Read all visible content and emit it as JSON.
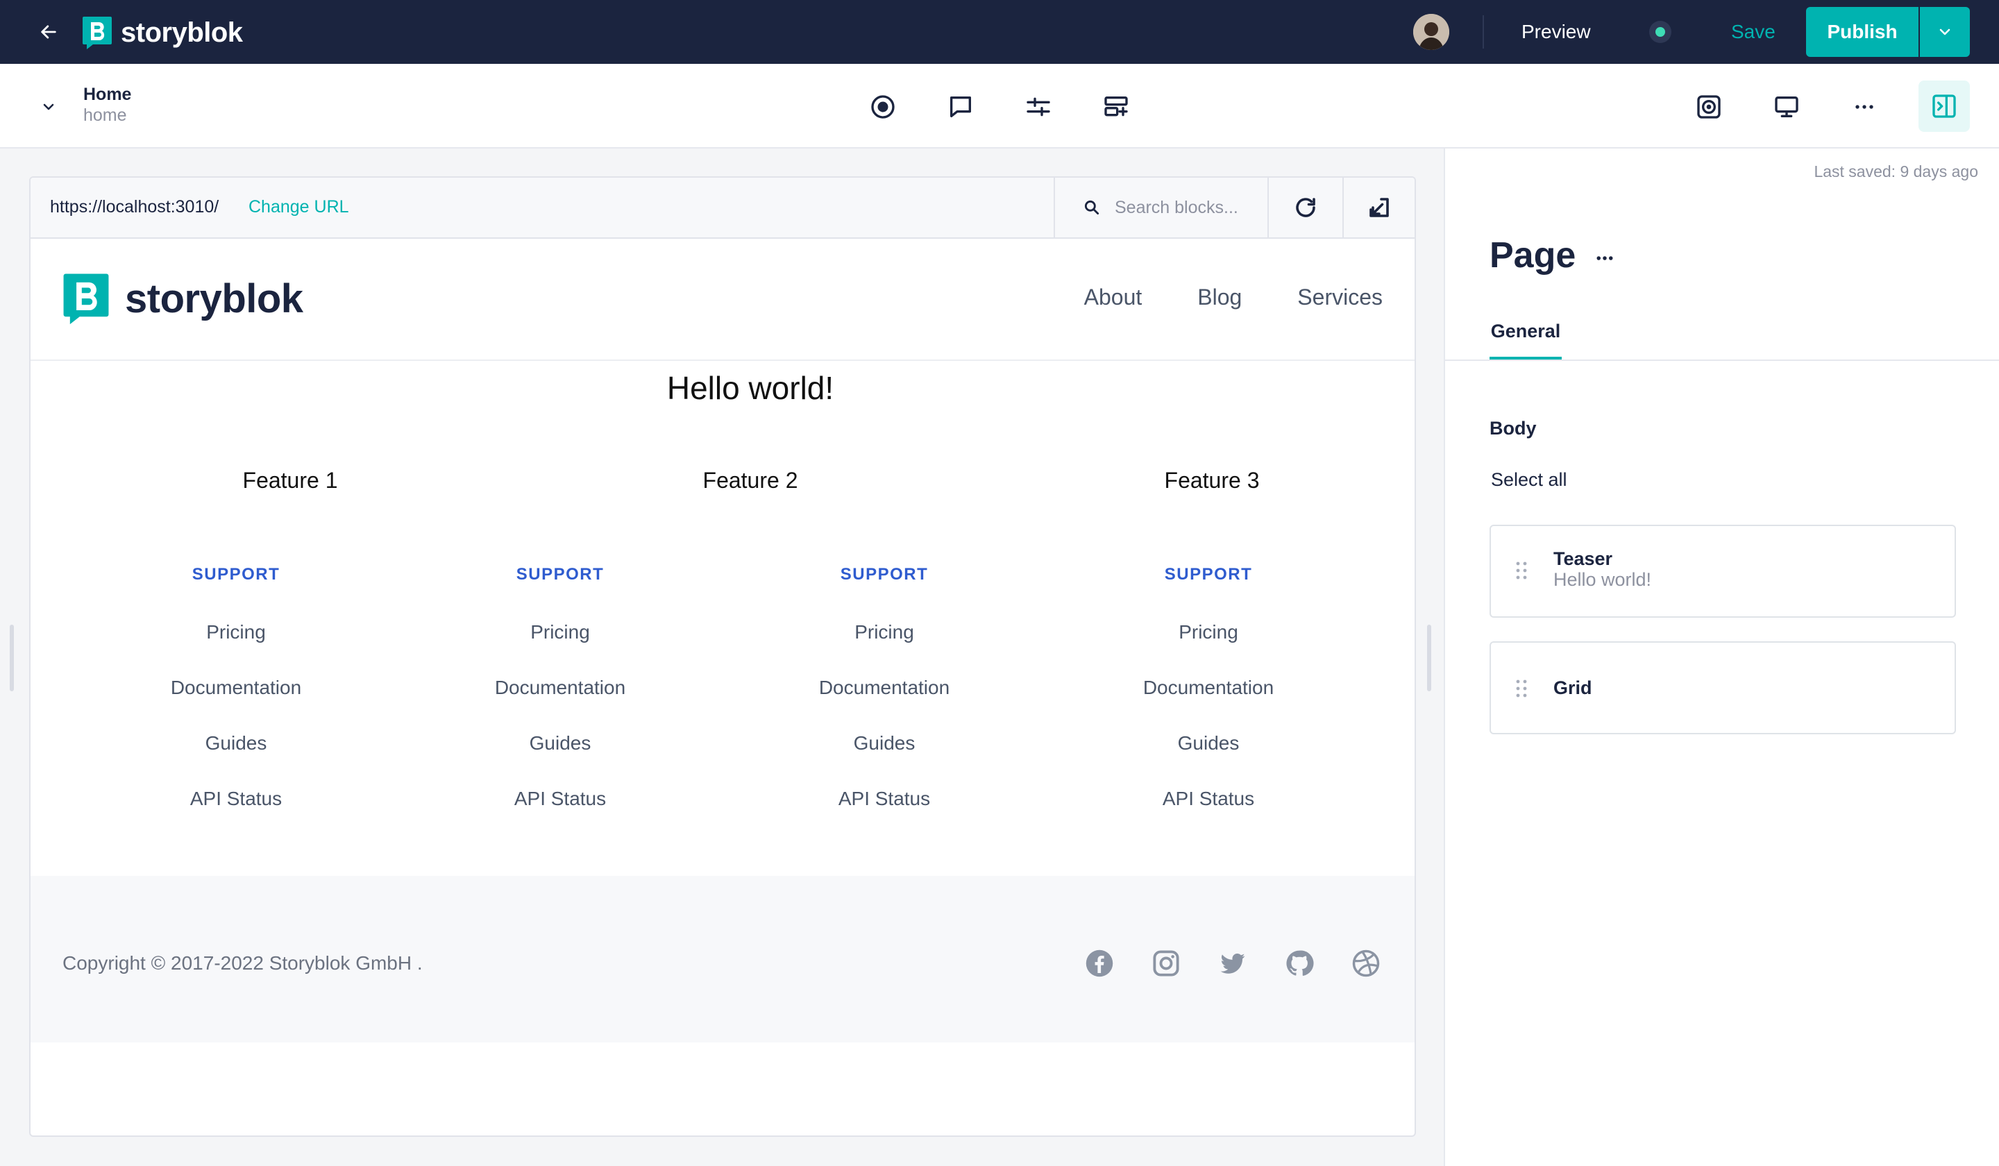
{
  "app": {
    "brand": "storyblok",
    "preview_label": "Preview",
    "save_label": "Save",
    "publish_label": "Publish"
  },
  "story": {
    "title": "Home",
    "slug": "home"
  },
  "toolbar_icons": [
    "target-icon",
    "comment-icon",
    "sliders-icon",
    "add-block-icon"
  ],
  "toolbar_right_icons": [
    "screenshot-icon",
    "desktop-icon",
    "more-icon",
    "panel-toggle-icon"
  ],
  "preview": {
    "url": "https://localhost:3010/",
    "change_url_label": "Change URL",
    "search_placeholder": "Search blocks..."
  },
  "site": {
    "logo_text": "storyblok",
    "nav": [
      "About",
      "Blog",
      "Services"
    ],
    "hero_title": "Hello world!",
    "features": [
      "Feature 1",
      "Feature 2",
      "Feature 3"
    ],
    "link_columns": [
      {
        "heading": "SUPPORT",
        "links": [
          "Pricing",
          "Documentation",
          "Guides",
          "API Status"
        ]
      },
      {
        "heading": "SUPPORT",
        "links": [
          "Pricing",
          "Documentation",
          "Guides",
          "API Status"
        ]
      },
      {
        "heading": "SUPPORT",
        "links": [
          "Pricing",
          "Documentation",
          "Guides",
          "API Status"
        ]
      },
      {
        "heading": "SUPPORT",
        "links": [
          "Pricing",
          "Documentation",
          "Guides",
          "API Status"
        ]
      }
    ],
    "copyright": "Copyright © 2017-2022  Storyblok GmbH  .",
    "social_icons": [
      "facebook-icon",
      "instagram-icon",
      "twitter-icon",
      "github-icon",
      "dribbble-icon"
    ]
  },
  "panel": {
    "last_saved": "Last saved: 9 days ago",
    "title": "Page",
    "tab": "General",
    "body_label": "Body",
    "select_all": "Select all",
    "blocks": [
      {
        "title": "Teaser",
        "subtitle": "Hello world!"
      },
      {
        "title": "Grid",
        "subtitle": ""
      }
    ]
  },
  "colors": {
    "topbar": "#1b243f",
    "accent": "#00b3b0",
    "link_heading": "#2f5ccf"
  }
}
